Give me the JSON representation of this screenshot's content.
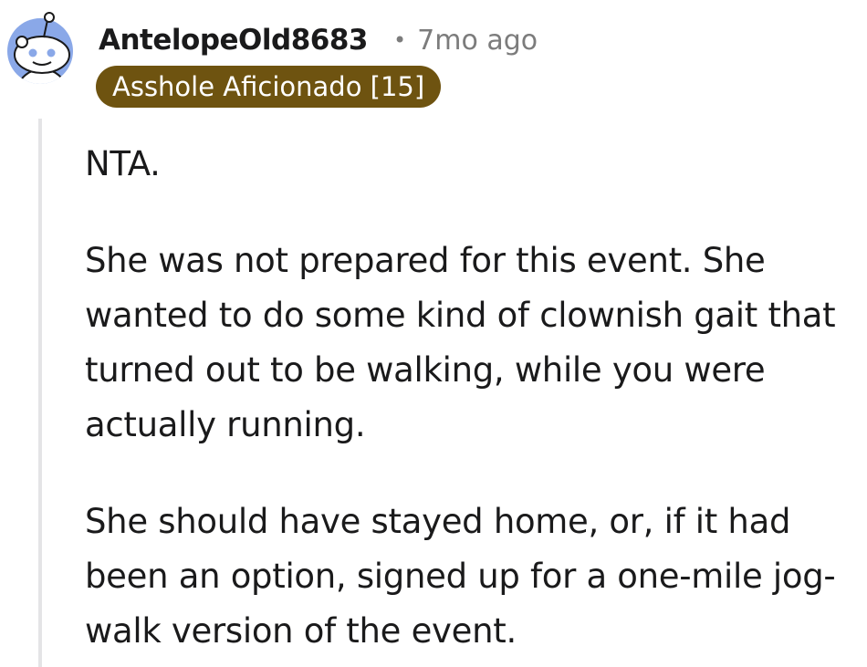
{
  "comment": {
    "author": "AntelopeOld8683",
    "separator": "•",
    "timestamp": "7mo ago",
    "flair": "Asshole Aficionado [15]",
    "avatar_icon": "snoo-avatar-icon",
    "paragraphs": [
      "NTA.",
      "She was not prepared for this event. She wanted to do some kind of clownish gait that turned out to be walking, while you were actually running.",
      "She should have stayed home, or, if it had been an option, signed up for a one-mile jog-walk version of the event."
    ]
  },
  "colors": {
    "flair_bg": "#6e5310",
    "avatar_bg": "#8aa8e8",
    "thread_line": "#e4e4e6",
    "meta_text": "#7c7c7c"
  }
}
